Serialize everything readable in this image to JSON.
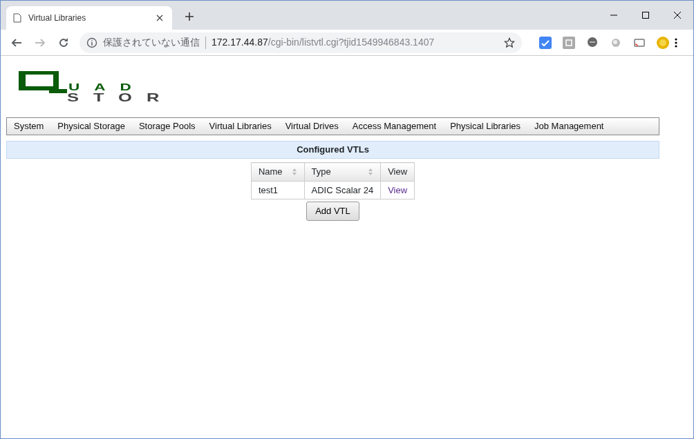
{
  "browser": {
    "tab": {
      "title": "Virtual Libraries"
    },
    "address": {
      "security": "保護されていない通信",
      "host": "172.17.44.87",
      "path": "/cgi-bin/listvtl.cgi?tjid1549946843.1407"
    }
  },
  "logo": {
    "top": "UAD",
    "bottom": "STOR"
  },
  "menu": [
    {
      "label": "System"
    },
    {
      "label": "Physical Storage"
    },
    {
      "label": "Storage Pools"
    },
    {
      "label": "Virtual Libraries"
    },
    {
      "label": "Virtual Drives"
    },
    {
      "label": "Access Management"
    },
    {
      "label": "Physical Libraries"
    },
    {
      "label": "Job Management"
    }
  ],
  "section": {
    "title": "Configured VTLs"
  },
  "table": {
    "columns": [
      {
        "label": "Name",
        "sortable": true
      },
      {
        "label": "Type",
        "sortable": true
      },
      {
        "label": "View",
        "sortable": false
      }
    ],
    "rows": [
      {
        "name": "test1",
        "type": "ADIC Scalar 24",
        "view": "View"
      }
    ]
  },
  "buttons": [
    "Add VTL"
  ]
}
